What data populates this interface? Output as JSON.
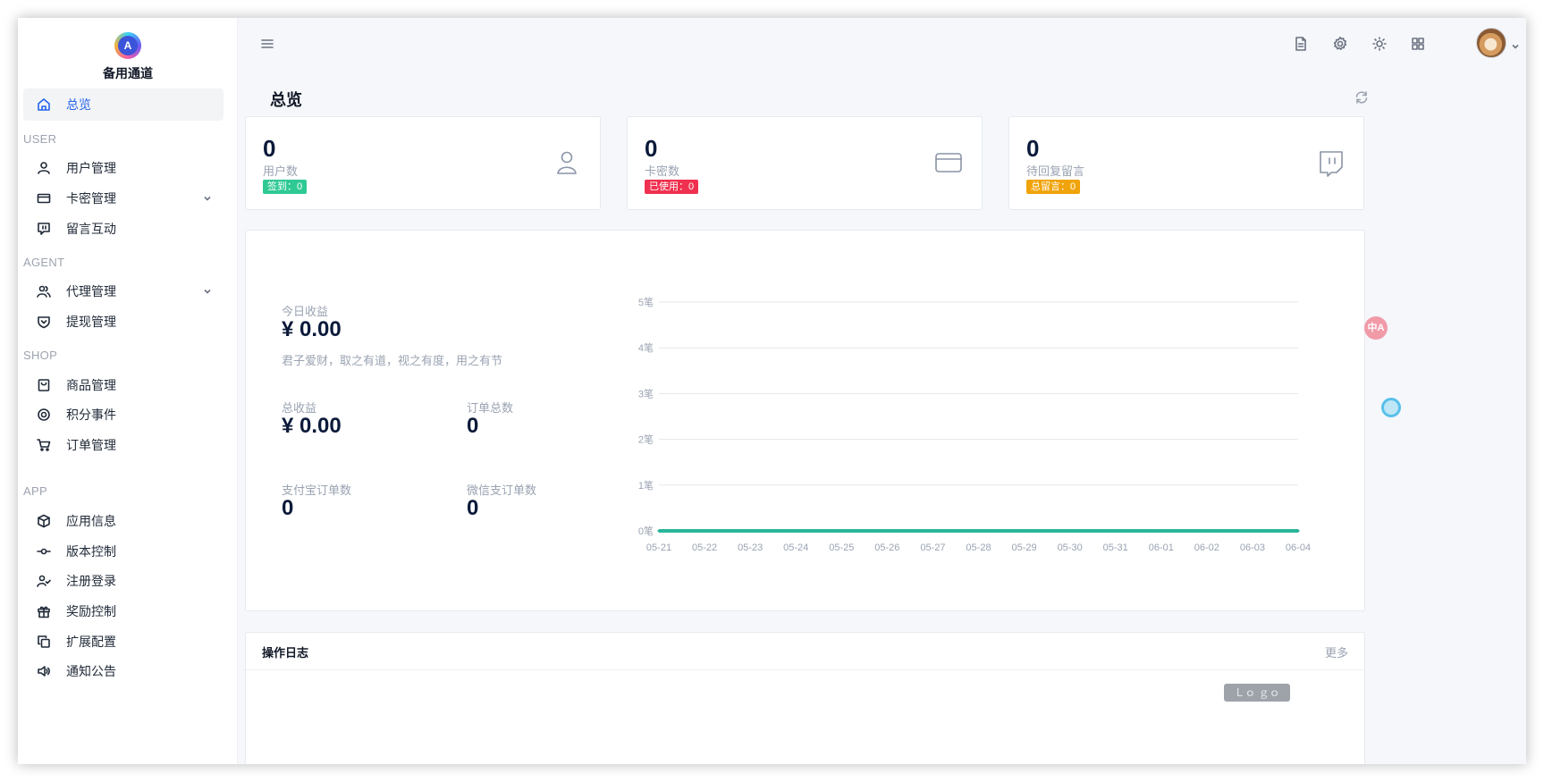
{
  "brand": {
    "logo_letter": "A",
    "name": "备用通道"
  },
  "sidebar": {
    "overview": {
      "label": "总览",
      "icon": "home-icon"
    },
    "sections": {
      "user": "USER",
      "agent": "AGENT",
      "shop": "SHOP",
      "app": "APP"
    },
    "items": {
      "users": {
        "label": "用户管理",
        "icon": "user-icon"
      },
      "cards": {
        "label": "卡密管理",
        "icon": "card-icon"
      },
      "messages": {
        "label": "留言互动",
        "icon": "message-icon"
      },
      "agents": {
        "label": "代理管理",
        "icon": "users-icon"
      },
      "withdraw": {
        "label": "提现管理",
        "icon": "shield-icon"
      },
      "products": {
        "label": "商品管理",
        "icon": "bag-icon"
      },
      "points": {
        "label": "积分事件",
        "icon": "target-icon"
      },
      "orders": {
        "label": "订单管理",
        "icon": "cart-icon"
      },
      "app_info": {
        "label": "应用信息",
        "icon": "box-icon"
      },
      "version": {
        "label": "版本控制",
        "icon": "commit-icon"
      },
      "register": {
        "label": "注册登录",
        "icon": "user-check-icon"
      },
      "rewards": {
        "label": "奖励控制",
        "icon": "gift-icon"
      },
      "extension": {
        "label": "扩展配置",
        "icon": "copy-icon"
      },
      "notice": {
        "label": "通知公告",
        "icon": "speaker-icon"
      }
    }
  },
  "page": {
    "title": "总览"
  },
  "stats": [
    {
      "value": "0",
      "label": "用户数",
      "badge": "签到：0",
      "badge_color": "#2fc994",
      "icon": "user-icon"
    },
    {
      "value": "0",
      "label": "卡密数",
      "badge": "已使用：0",
      "badge_color": "#f0304f",
      "icon": "card-icon"
    },
    {
      "value": "0",
      "label": "待回复留言",
      "badge": "总留言：0",
      "badge_color": "#f0a30a",
      "icon": "message-icon"
    }
  ],
  "revenue": {
    "today_label": "今日收益",
    "today_value": "¥ 0.00",
    "motto": "君子爱财，取之有道，视之有度，用之有节",
    "total_label": "总收益",
    "total_value": "¥ 0.00",
    "orders_label": "订单总数",
    "orders_value": "0",
    "alipay_label": "支付宝订单数",
    "alipay_value": "0",
    "wechat_label": "微信支订单数",
    "wechat_value": "0"
  },
  "chart_data": {
    "type": "line",
    "x": [
      "05-21",
      "05-22",
      "05-23",
      "05-24",
      "05-25",
      "05-26",
      "05-27",
      "05-28",
      "05-29",
      "05-30",
      "05-31",
      "06-01",
      "06-02",
      "06-03",
      "06-04"
    ],
    "y_ticks": [
      "0笔",
      "1笔",
      "2笔",
      "3笔",
      "4笔",
      "5笔"
    ],
    "ylim": [
      0,
      5
    ],
    "series": [
      {
        "values": [
          0,
          0,
          0,
          0,
          0,
          0,
          0,
          0,
          0,
          0,
          0,
          0,
          0,
          0,
          0
        ],
        "color": "#2bb59a"
      }
    ],
    "grid": true
  },
  "logs": {
    "title": "操作日志",
    "more": "更多",
    "chip": "Ｌｏ ｇｏ"
  },
  "floating": {
    "translate": "中A"
  }
}
